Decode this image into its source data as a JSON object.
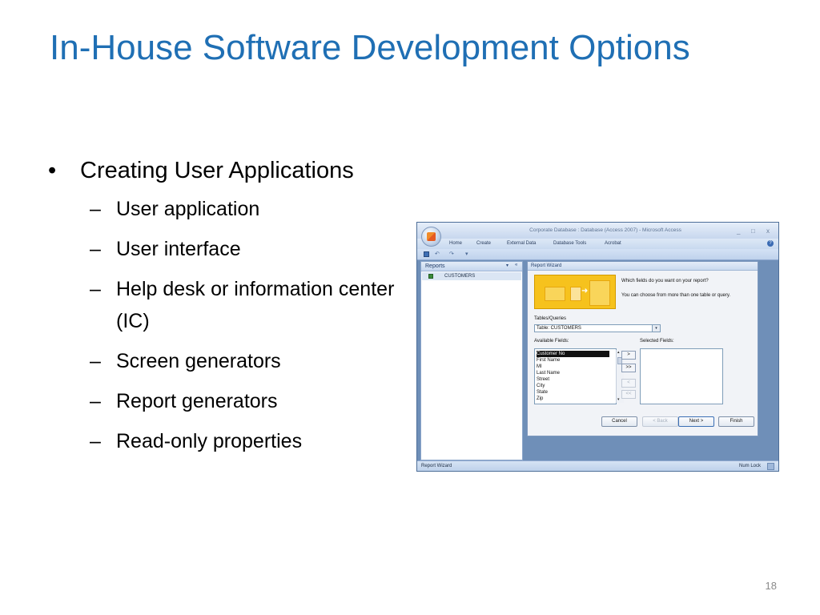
{
  "slide": {
    "title": "In-House Software Development Options",
    "bullet_marker": "•",
    "sub_marker": "–",
    "bullet": "Creating User Applications",
    "sub_items": [
      "User application",
      "User interface",
      "Help desk or information center (IC)",
      "Screen generators",
      "Report generators",
      "Read-only properties"
    ],
    "page_number": "18",
    "colors": {
      "title": "#1f6fb4",
      "text": "#000000"
    }
  },
  "access": {
    "window_title": "Corporate Database : Database (Access 2007) - Microsoft Access",
    "window_controls": {
      "minimize": "_",
      "maximize": "□",
      "close": "x"
    },
    "ribbon_tabs": [
      "Home",
      "Create",
      "External Data",
      "Database Tools",
      "Acrobat"
    ],
    "qat": {
      "undo": "↶",
      "redo": "↷",
      "customize": "▾"
    },
    "nav_pane": {
      "title": "Reports",
      "dropdown": "▾",
      "collapse": "«",
      "items": [
        "CUSTOMERS"
      ]
    },
    "wizard": {
      "title": "Report Wizard",
      "question": "Which fields do you want on your report?",
      "hint": "You can choose from more than one table or query.",
      "tables_label": "Tables/Queries",
      "table_value": "Table: CUSTOMERS",
      "available_label": "Available Fields:",
      "selected_label": "Selected Fields:",
      "available_fields": [
        "Customer No",
        "First Name",
        "MI",
        "Last Name",
        "Street",
        "City",
        "State",
        "Zip"
      ],
      "move_buttons": [
        ">",
        ">>",
        "<",
        "<<"
      ],
      "buttons": {
        "cancel": "Cancel",
        "back": "< Back",
        "next": "Next >",
        "finish": "Finish"
      }
    },
    "status": {
      "left": "Report Wizard",
      "right": "Num Lock"
    }
  }
}
